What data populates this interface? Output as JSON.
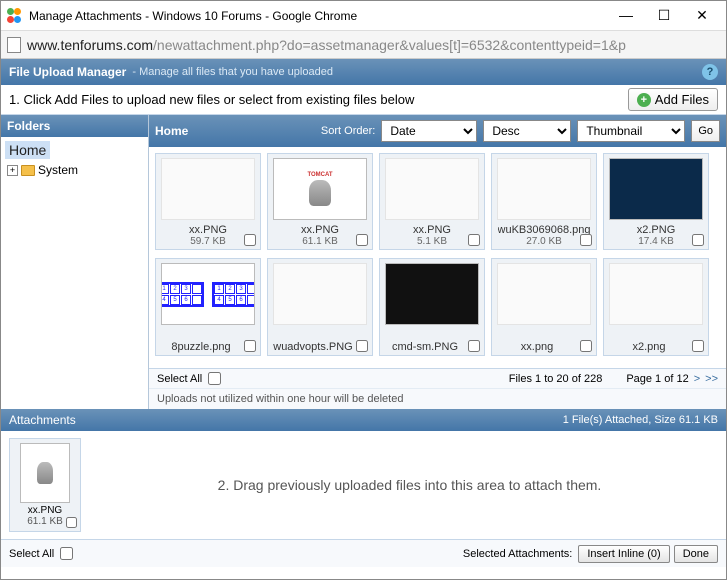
{
  "window": {
    "title": "Manage Attachments - Windows 10 Forums - Google Chrome",
    "minimize": "—",
    "maximize": "☐",
    "close": "✕"
  },
  "address": {
    "host": "www.tenforums.com",
    "path": "/newattachment.php?do=assetmanager&values[t]=6532&contenttypeid=1&p"
  },
  "header": {
    "title": "File Upload Manager",
    "subtitle": "-  Manage all files that you have uploaded",
    "help": "?"
  },
  "instruction": {
    "text": "1. Click Add Files to upload new files or select from existing files below",
    "addfiles": "Add Files"
  },
  "folders": {
    "heading": "Folders",
    "home": "Home",
    "expand": "+",
    "system": "System"
  },
  "content": {
    "breadcrumb": "Home",
    "sort_label": "Sort Order:",
    "sort_field": "Date",
    "sort_dir": "Desc",
    "sort_view": "Thumbnail",
    "go": "Go"
  },
  "files_row1": [
    {
      "name": "xx.PNG",
      "size": "59.7 KB"
    },
    {
      "name": "xx.PNG",
      "size": "61.1 KB"
    },
    {
      "name": "xx.PNG",
      "size": "5.1 KB"
    },
    {
      "name": "wuKB3069068.png",
      "size": "27.0 KB"
    },
    {
      "name": "x2.PNG",
      "size": "17.4 KB"
    }
  ],
  "files_row2": [
    {
      "name": "8puzzle.png"
    },
    {
      "name": "wuadvopts.PNG"
    },
    {
      "name": "cmd-sm.PNG"
    },
    {
      "name": "xx.png"
    },
    {
      "name": "x2.png"
    }
  ],
  "status": {
    "select_all": "Select All",
    "range": "Files 1 to 20 of 228",
    "page": "Page 1 of 12",
    "next": ">",
    "last": ">>"
  },
  "note": "Uploads not utilized within one hour will be deleted",
  "attachments": {
    "heading": "Attachments",
    "info": "1 File(s) Attached, Size 61.1 KB",
    "item": {
      "name": "xx.PNG",
      "size": "61.1 KB"
    },
    "hint": "2. Drag previously uploaded files into this area to attach them."
  },
  "bottom": {
    "select_all": "Select All",
    "label": "Selected Attachments:",
    "insert": "Insert Inline (0)",
    "done": "Done"
  }
}
